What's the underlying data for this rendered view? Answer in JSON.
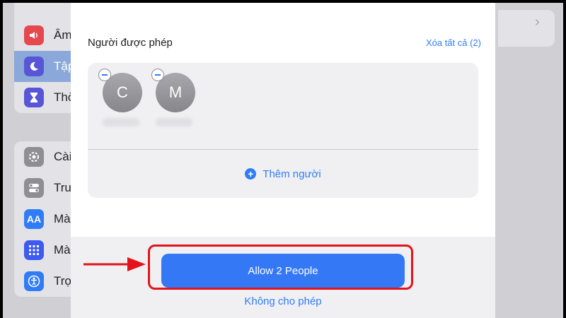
{
  "settings": {
    "group1": [
      {
        "label": "Âm",
        "icon": "speaker-icon",
        "color": "#e5484d",
        "selected": false
      },
      {
        "label": "Tập",
        "icon": "moon-icon",
        "color": "#5856d6",
        "selected": true
      },
      {
        "label": "Thờ",
        "icon": "hourglass-icon",
        "color": "#5856d6",
        "selected": false
      }
    ],
    "group2": [
      {
        "label": "Cài",
        "icon": "gear-icon",
        "color": "#8e8e93"
      },
      {
        "label": "Tru",
        "icon": "toggle-icon",
        "color": "#8e8e93"
      },
      {
        "label": "Màn",
        "icon": "text-size-icon",
        "color": "#2f7cf6",
        "glyph": "AA"
      },
      {
        "label": "Màn",
        "icon": "grid-icon",
        "color": "#3d5af1"
      },
      {
        "label": "Trợ",
        "icon": "accessibility-icon",
        "color": "#2f7cf6"
      }
    ]
  },
  "sheet": {
    "section_title": "Người được phép",
    "clear_all": "Xóa tất cả (2)",
    "people": [
      {
        "initial": "C"
      },
      {
        "initial": "M"
      }
    ],
    "add_person": "Thêm người"
  },
  "footer": {
    "allow_label": "Allow 2 People",
    "deny_label": "Không cho phép"
  },
  "colors": {
    "accent": "#2f7cf6",
    "annotation": "#e3131b"
  }
}
